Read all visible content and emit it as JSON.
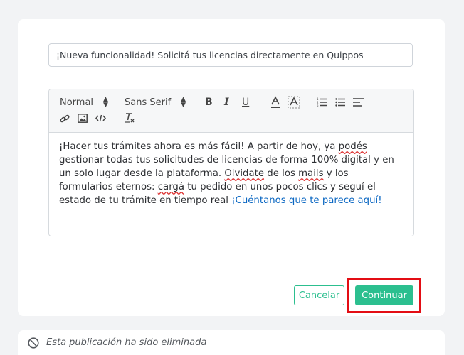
{
  "post": {
    "subject": "¡Nueva funcionalidad! Solicitá tus licencias directamente en Quippos"
  },
  "toolbar": {
    "format_select": "Normal",
    "font_select": "Sans Serif",
    "icons": [
      "bold-icon",
      "italic-icon",
      "underline-icon",
      "text-color-icon",
      "background-color-icon",
      "ordered-list-icon",
      "bullet-list-icon",
      "align-icon",
      "link-icon",
      "image-icon",
      "code-icon",
      "clear-format-icon"
    ]
  },
  "body": {
    "t1": "¡Hacer tus trámites ahora es más fácil! A partir de hoy, ya ",
    "w1": "podés",
    "t2": " gestionar todas tus solicitudes de licencias de forma 100% digital y en un solo lugar desde la plataforma. ",
    "w2": "Olvidate",
    "t3": " de los ",
    "w3": "mails",
    "t4": " y los formularios eternos: ",
    "w4": "cargá",
    "t5": " tu pedido en unos pocos clics y seguí el estado de tu trámite en tiempo real ",
    "link": "¡Cuéntanos que te parece aquí!"
  },
  "actions": {
    "cancel": "Cancelar",
    "continue": "Continuar"
  },
  "deleted_notice": "Esta publicación ha sido eliminada",
  "colors": {
    "accent": "#2cbf8f",
    "highlight": "#e30d14",
    "link": "#0b67c2"
  }
}
